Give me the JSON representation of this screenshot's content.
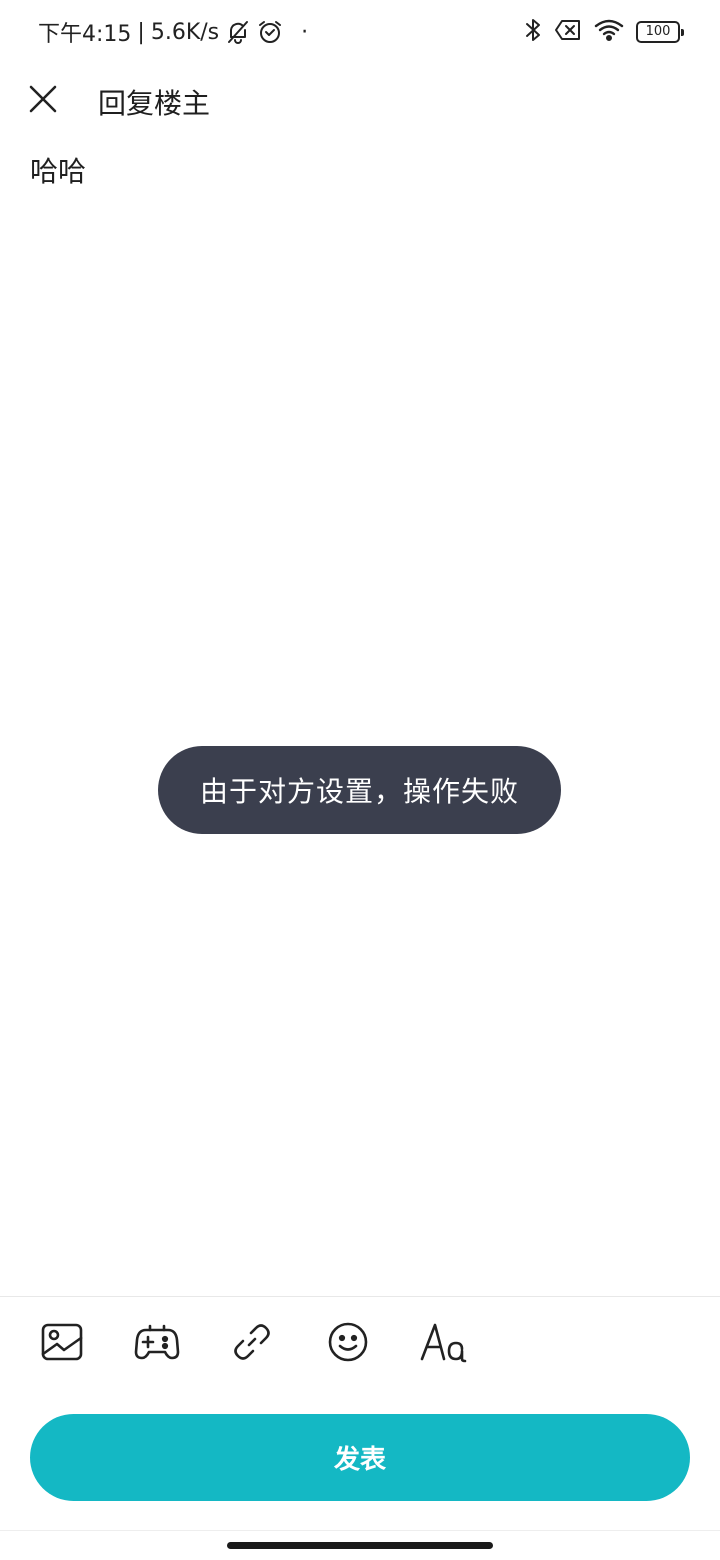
{
  "status_bar": {
    "time": "下午4:15",
    "separator": "|",
    "speed": "5.6K/s",
    "dot": "·",
    "battery": "100",
    "icons": [
      "bell-off-icon",
      "alarm-icon",
      "bluetooth-icon",
      "sim-error-icon",
      "wifi-icon",
      "battery-icon"
    ]
  },
  "header": {
    "title": "回复楼主",
    "close_icon": "close-icon"
  },
  "editor": {
    "content": "哈哈"
  },
  "toast": {
    "message": "由于对方设置，操作失败"
  },
  "toolbar": {
    "items": [
      "image-icon",
      "game-controller-icon",
      "link-icon",
      "emoji-icon",
      "text-format-icon"
    ]
  },
  "publish": {
    "label": "发表"
  },
  "colors": {
    "accent": "#14b8c4",
    "toast_bg": "#3b3f4e",
    "text": "#1f1f1f"
  }
}
